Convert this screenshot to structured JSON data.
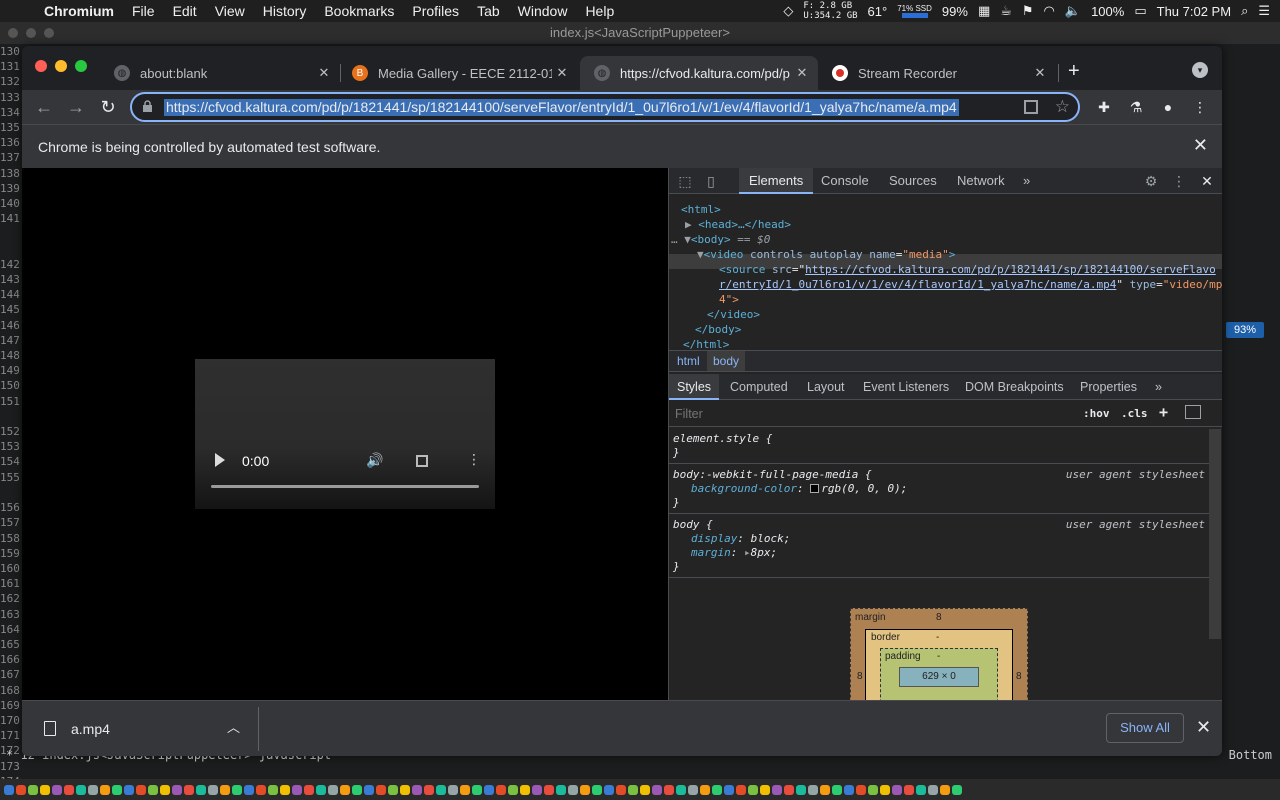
{
  "menubar": {
    "app": "Chromium",
    "items": [
      "File",
      "Edit",
      "View",
      "History",
      "Bookmarks",
      "Profiles",
      "Tab",
      "Window",
      "Help"
    ],
    "mem_free": "F:   2.8 GB",
    "mem_used": "U:354.2 GB",
    "temp": "61°",
    "ssd": "71% SSD",
    "ssd_percent": "99%",
    "battery": "100%",
    "clock": "Thu 7:02 PM"
  },
  "terminal": {
    "title": "index.js<JavaScriptPuppeteer>",
    "line_numbers": [
      "130",
      "131",
      "132",
      "133",
      "134",
      "135",
      "136",
      "137",
      "138",
      "139",
      "140",
      "141",
      "",
      "",
      "142",
      "143",
      "144",
      "145",
      "146",
      "147",
      "148",
      "149",
      "150",
      "151",
      "",
      "152",
      "153",
      "154",
      "155",
      "",
      "156",
      "157",
      "158",
      "159",
      "160",
      "161",
      "162",
      "163",
      "164",
      "165",
      "166",
      "167",
      "168",
      "169",
      "170",
      "171",
      "172",
      "173",
      "174"
    ],
    "status_left": "* 12  index.js<JavaScriptPuppeteer>  javascript",
    "status_right": "Bottom",
    "zoom_badge": "93%"
  },
  "browser": {
    "tabs": [
      {
        "title": "about:blank",
        "favicon": "globe-icon"
      },
      {
        "title": "Media Gallery - EECE 2112-01",
        "favicon": "kaltura-icon"
      },
      {
        "title": "https://cfvod.kaltura.com/pd/p",
        "favicon": "globe-icon"
      },
      {
        "title": "Stream Recorder",
        "favicon": "record-icon"
      }
    ],
    "url": "https://cfvod.kaltura.com/pd/p/1821441/sp/182144100/serveFlavor/entryId/1_0u7l6ro1/v/1/ev/4/flavorId/1_yalya7hc/name/a.mp4",
    "infobar": "Chrome is being controlled by automated test software."
  },
  "video": {
    "time": "0:00"
  },
  "devtools": {
    "tabs": [
      "Elements",
      "Console",
      "Sources",
      "Network"
    ],
    "more": "»",
    "dom": {
      "html_open": "<html>",
      "head": "<head>…</head>",
      "body_open": "<body>",
      "body_ref": "== $0",
      "video_tag": "<video",
      "video_attrs": " controls autoplay ",
      "name_attr": "name",
      "name_val": "\"media\"",
      "source_tag": "<source ",
      "src_attr": "src",
      "src_val_1": "https://cfvod.kaltura.com/pd/p/1821441/sp/182144100/serveFlavo",
      "src_val_2": "r/entryId/1_0u7l6ro1/v/1/ev/4/flavorId/1_yalya7hc/name/a.mp4",
      "type_attr": "type",
      "type_val_1": "\"video/mp",
      "type_val_2": "4\">",
      "video_close": "</video>",
      "body_close": "</body>",
      "html_close": "</html>"
    },
    "breadcrumbs": [
      "html",
      "body"
    ],
    "sub_tabs": [
      "Styles",
      "Computed",
      "Layout",
      "Event Listeners",
      "DOM Breakpoints",
      "Properties"
    ],
    "filter_placeholder": "Filter",
    "hov": ":hov",
    "cls": ".cls",
    "rules": [
      {
        "selector": "element.style {",
        "close": "}"
      },
      {
        "selector": "body:-webkit-full-page-media {",
        "origin": "user agent stylesheet",
        "props": [
          {
            "name": "background-color",
            "value": "rgb(0, 0, 0);"
          }
        ],
        "close": "}"
      },
      {
        "selector": "body {",
        "origin": "user agent stylesheet",
        "props": [
          {
            "name": "display",
            "value": "block;"
          },
          {
            "name": "margin",
            "value": "8px;"
          }
        ],
        "close": "}"
      }
    ],
    "boxmodel": {
      "margin_label": "margin",
      "margin_top": "8",
      "margin_left": "8",
      "margin_right": "8",
      "border_label": "border",
      "border_val": "-",
      "padding_label": "padding",
      "padding_val": "-",
      "content": "629 × 0"
    }
  },
  "downloads": {
    "file": "a.mp4",
    "show_all": "Show All"
  }
}
